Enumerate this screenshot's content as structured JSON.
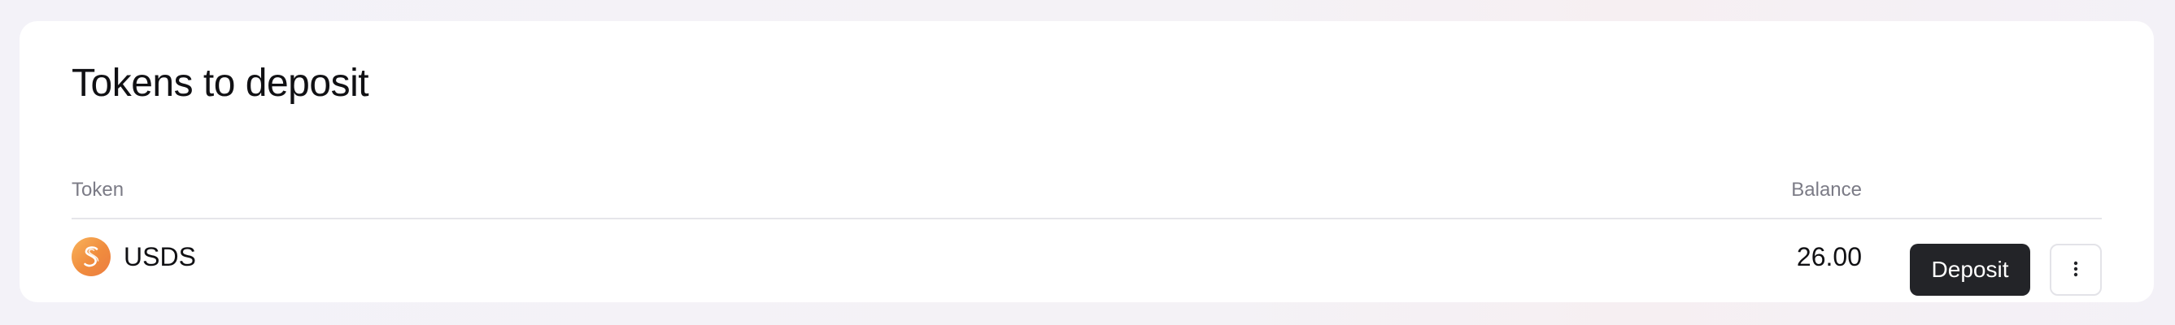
{
  "card": {
    "title": "Tokens to deposit"
  },
  "table": {
    "columns": {
      "token": "Token",
      "balance": "Balance"
    },
    "rows": [
      {
        "token_icon": "usds-token-icon",
        "token": "USDS",
        "balance": "26.00",
        "action_label": "Deposit",
        "more_icon": "vertical-ellipsis-icon"
      }
    ]
  },
  "colors": {
    "primary_button": "#232428",
    "token_icon": "#F0913F",
    "muted_text": "#7B7B86"
  }
}
